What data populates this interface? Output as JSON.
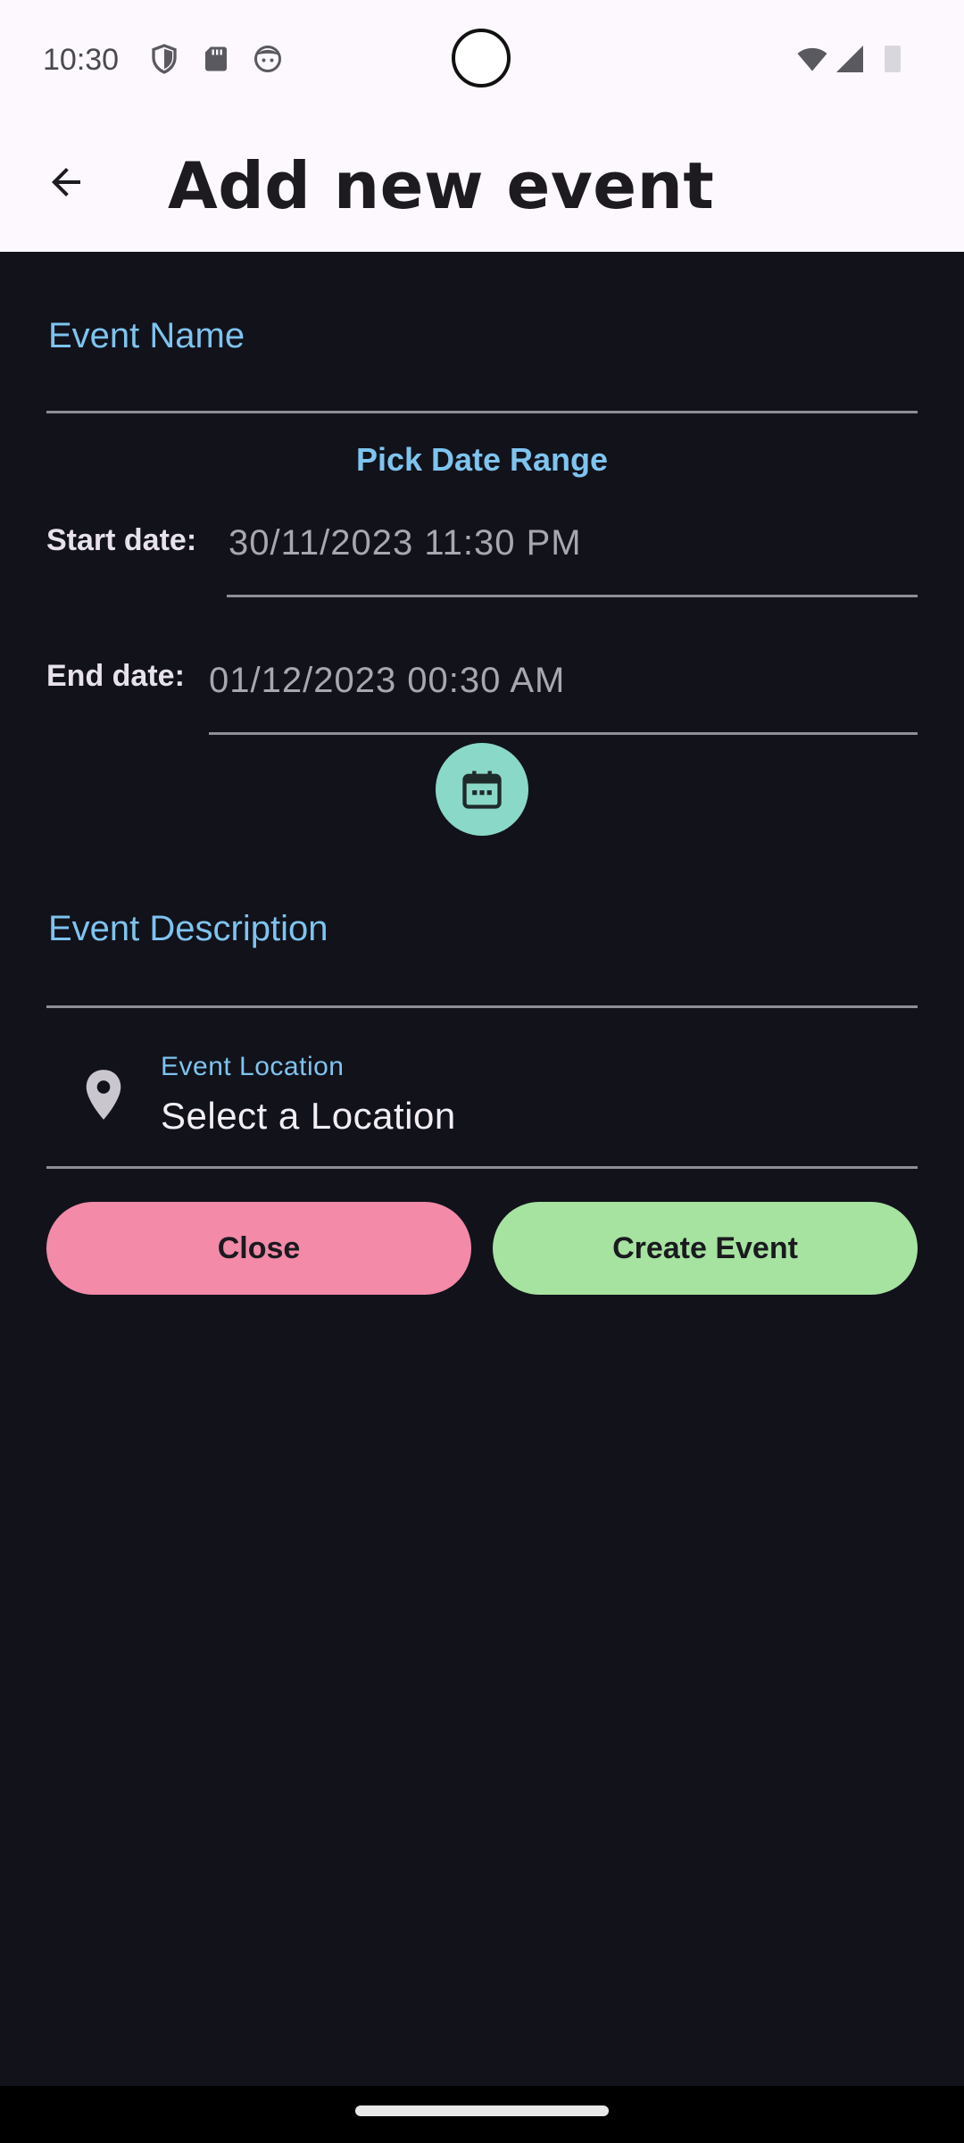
{
  "status_bar": {
    "time": "10:30",
    "icons": [
      "shield-icon",
      "sd-card-icon",
      "face-icon",
      "wifi-icon",
      "signal-icon",
      "battery-icon"
    ]
  },
  "app_bar": {
    "title": "Add new event",
    "back_icon": "arrow-back-icon"
  },
  "form": {
    "event_name_label": "Event Name",
    "pick_date_range": "Pick Date Range",
    "start_date_label": "Start date:",
    "start_date_value": "30/11/2023 11:30 PM",
    "end_date_label": "End date:",
    "end_date_value": "01/12/2023 00:30 AM",
    "calendar_icon": "calendar-icon",
    "event_description_label": "Event Description",
    "location_label": "Event Location",
    "location_value": "Select a Location",
    "location_icon": "location-pin-icon"
  },
  "actions": {
    "close_label": "Close",
    "create_label": "Create Event"
  },
  "colors": {
    "background": "#12121b",
    "accent_label": "#7ec4ef",
    "fab": "#8ad8c8",
    "close_button": "#f28aa8",
    "create_button": "#a6e2a0"
  }
}
